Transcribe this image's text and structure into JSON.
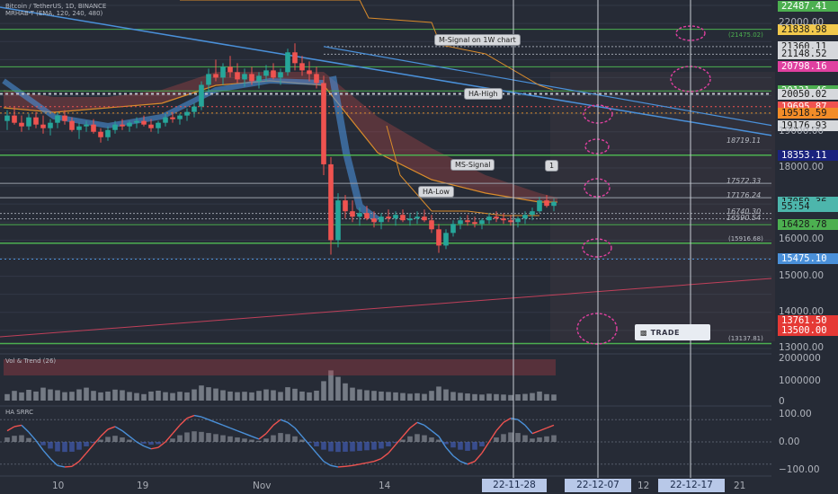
{
  "header": {
    "symbol_line": "Bitcoin / TetherUS, 1D, BINANCE",
    "indicator_line": "MRHAB-T (EMA, 120, 240, 480)"
  },
  "colors": {
    "background": "#262b36",
    "bull": "#26a69a",
    "bear": "#ef5350",
    "green_line": "#4caf50",
    "blue_line": "#4a90d9",
    "orange_line": "#d98b2b",
    "magenta": "#e040a0"
  },
  "chart_data": [
    {
      "type": "candlestick",
      "title": "Bitcoin / TetherUS, 1D, BINANCE",
      "ylim": [
        13000,
        22500
      ],
      "x_tick_labels": [
        "10",
        "19",
        "Nov",
        "14",
        "12",
        "21"
      ],
      "selected_dates": [
        "22-11-28",
        "22-12-07",
        "22-12-17"
      ],
      "candles": [
        [
          19300,
          19600,
          19050,
          19450
        ],
        [
          19450,
          19700,
          19200,
          19250
        ],
        [
          19250,
          19450,
          19000,
          19150
        ],
        [
          19150,
          19500,
          19050,
          19400
        ],
        [
          19400,
          19550,
          19100,
          19200
        ],
        [
          19200,
          19450,
          18950,
          19100
        ],
        [
          19100,
          19350,
          18900,
          19250
        ],
        [
          19250,
          19550,
          19100,
          19450
        ],
        [
          19450,
          19600,
          19200,
          19300
        ],
        [
          19300,
          19400,
          19000,
          19050
        ],
        [
          19050,
          19250,
          18800,
          19150
        ],
        [
          19150,
          19300,
          19000,
          19200
        ],
        [
          19200,
          19350,
          18950,
          19000
        ],
        [
          19000,
          19100,
          18700,
          18850
        ],
        [
          18850,
          19150,
          18750,
          19050
        ],
        [
          19050,
          19300,
          18950,
          19200
        ],
        [
          19200,
          19350,
          19050,
          19150
        ],
        [
          19150,
          19300,
          19000,
          19250
        ],
        [
          19250,
          19400,
          19100,
          19300
        ],
        [
          19300,
          19450,
          19150,
          19200
        ],
        [
          19200,
          19350,
          19000,
          19100
        ],
        [
          19100,
          19300,
          18950,
          19250
        ],
        [
          19250,
          19500,
          19150,
          19400
        ],
        [
          19400,
          19550,
          19250,
          19350
        ],
        [
          19350,
          19500,
          19200,
          19450
        ],
        [
          19450,
          19650,
          19300,
          19550
        ],
        [
          19550,
          19800,
          19400,
          19700
        ],
        [
          19700,
          20400,
          19600,
          20300
        ],
        [
          20300,
          20750,
          20100,
          20600
        ],
        [
          20600,
          21000,
          20400,
          20500
        ],
        [
          20500,
          20900,
          20300,
          20800
        ],
        [
          20800,
          21100,
          20500,
          20650
        ],
        [
          20650,
          20900,
          20350,
          20450
        ],
        [
          20450,
          20750,
          20250,
          20600
        ],
        [
          20600,
          20800,
          20300,
          20400
        ],
        [
          20400,
          20650,
          20200,
          20550
        ],
        [
          20550,
          20850,
          20400,
          20700
        ],
        [
          20700,
          20900,
          20450,
          20500
        ],
        [
          20500,
          20750,
          20300,
          20650
        ],
        [
          20650,
          21300,
          20550,
          21200
        ],
        [
          21200,
          21450,
          20700,
          20900
        ],
        [
          20900,
          21100,
          20550,
          20700
        ],
        [
          20700,
          20950,
          20400,
          20600
        ],
        [
          20600,
          20800,
          20200,
          20350
        ],
        [
          20350,
          20550,
          17800,
          18100
        ],
        [
          18100,
          18300,
          15600,
          16000
        ],
        [
          16000,
          17300,
          15800,
          17100
        ],
        [
          17100,
          17250,
          16600,
          16800
        ],
        [
          16800,
          17100,
          16500,
          16650
        ],
        [
          16650,
          16900,
          16400,
          16750
        ],
        [
          16750,
          16950,
          16550,
          16600
        ],
        [
          16600,
          16800,
          16350,
          16500
        ],
        [
          16500,
          16750,
          16300,
          16650
        ],
        [
          16650,
          16850,
          16500,
          16600
        ],
        [
          16600,
          16800,
          16400,
          16700
        ],
        [
          16700,
          16850,
          16500,
          16550
        ],
        [
          16550,
          16750,
          16400,
          16600
        ],
        [
          16600,
          16800,
          16450,
          16650
        ],
        [
          16650,
          16850,
          16500,
          16550
        ],
        [
          16550,
          16700,
          16200,
          16300
        ],
        [
          16300,
          16450,
          15650,
          15850
        ],
        [
          15850,
          16300,
          15750,
          16200
        ],
        [
          16200,
          16550,
          16100,
          16450
        ],
        [
          16450,
          16650,
          16300,
          16550
        ],
        [
          16550,
          16700,
          16400,
          16500
        ],
        [
          16500,
          16650,
          16350,
          16450
        ],
        [
          16450,
          16600,
          16300,
          16550
        ],
        [
          16550,
          16750,
          16450,
          16650
        ],
        [
          16650,
          16800,
          16500,
          16600
        ],
        [
          16600,
          16750,
          16450,
          16550
        ],
        [
          16550,
          16700,
          16400,
          16500
        ],
        [
          16500,
          16650,
          16350,
          16600
        ],
        [
          16600,
          16800,
          16450,
          16700
        ],
        [
          16700,
          16900,
          16550,
          16800
        ],
        [
          16800,
          17200,
          16750,
          17100
        ],
        [
          17100,
          17250,
          16900,
          16950
        ],
        [
          16950,
          17150,
          16800,
          17059
        ]
      ],
      "price_labels": [
        {
          "value": "22487.41",
          "color": "#4caf50",
          "text_color": "#ffffff"
        },
        {
          "value": "21838.98",
          "color": "#f2c94c",
          "text_color": "#1a1a1a"
        },
        {
          "value": "21360.11",
          "color": "#d6d8dc",
          "text_color": "#1a1a1a"
        },
        {
          "value": "21148.52",
          "color": "#d6d8dc",
          "text_color": "#1a1a1a"
        },
        {
          "value": "20798.16",
          "color": "#e040a0",
          "text_color": "#ffffff"
        },
        {
          "value": "20131.46",
          "color": "#4caf50",
          "text_color": "#ffffff"
        },
        {
          "value": "20050.02",
          "color": "#d6d8dc",
          "text_color": "#1a1a1a"
        },
        {
          "value": "19695.87",
          "color": "#ef5350",
          "text_color": "#ffffff"
        },
        {
          "value": "19518.59",
          "color": "#f28c28",
          "text_color": "#1a1a1a"
        },
        {
          "value": "19176.93",
          "color": "#d6d8dc",
          "text_color": "#1a1a1a"
        },
        {
          "value": "18353.11",
          "color": "#1a237e",
          "text_color": "#ffffff"
        },
        {
          "value": "17059.36",
          "color": "#4db6ac",
          "text_color": "#1a1a1a"
        },
        {
          "value": "55:54",
          "color": "#4db6ac",
          "text_color": "#1a1a1a"
        },
        {
          "value": "16428.78",
          "color": "#4caf50",
          "text_color": "#1a1a1a"
        },
        {
          "value": "15475.10",
          "color": "#4a90d9",
          "text_color": "#ffffff"
        },
        {
          "value": "13761.50",
          "color": "#e53935",
          "text_color": "#ffffff"
        },
        {
          "value": "13500.00",
          "color": "#e53935",
          "text_color": "#ffffff"
        }
      ],
      "axis_prices": [
        "22000.00",
        "19000.00",
        "18000.00",
        "16000.00",
        "15000.00",
        "14000.00",
        "13000.00"
      ],
      "level_lines": [
        {
          "value": "18719.11",
          "label": "18719.11"
        },
        {
          "value": "17572.33",
          "label": "17572.33"
        },
        {
          "value": "17176.24",
          "label": "17176.24"
        },
        {
          "value": "16740.30",
          "label": "16740.30"
        },
        {
          "value": "16590.54",
          "label": "16590.54"
        },
        {
          "value": "15916.68",
          "label": "(15916.68)"
        },
        {
          "value": "13137.81",
          "label": "(13137.81)"
        },
        {
          "value": "21475.02",
          "label": "(21475.02)"
        }
      ],
      "annotations": [
        "M-Signal on 1W chart",
        "HA-High",
        "MS-Signal",
        "HA-Low",
        "1"
      ]
    },
    {
      "type": "bar",
      "title": "Vol & Trend (26)",
      "axis_ticks": [
        "2000000",
        "1000000",
        "0"
      ],
      "values": [
        300,
        450,
        380,
        500,
        420,
        600,
        520,
        480,
        390,
        410,
        520,
        600,
        450,
        380,
        420,
        510,
        480,
        400,
        350,
        300,
        420,
        460,
        390,
        350,
        410,
        380,
        520,
        700,
        620,
        560,
        480,
        420,
        390,
        410,
        380,
        450,
        520,
        480,
        400,
        620,
        550,
        420,
        380,
        460,
        900,
        1400,
        1100,
        800,
        600,
        520,
        480,
        450,
        420,
        400,
        380,
        350,
        320,
        340,
        310,
        450,
        650,
        520,
        400,
        360,
        330,
        300,
        280,
        320,
        300,
        280,
        260,
        290,
        310,
        350,
        420,
        300,
        280
      ]
    },
    {
      "type": "line",
      "title": "HA SRRC",
      "axis_ticks": [
        "100.00",
        "0.00",
        "−100.00"
      ],
      "values": [
        40,
        55,
        60,
        35,
        5,
        -30,
        -60,
        -85,
        -90,
        -88,
        -70,
        -40,
        -10,
        20,
        45,
        55,
        40,
        20,
        0,
        -15,
        -25,
        -20,
        0,
        30,
        60,
        85,
        95,
        90,
        80,
        70,
        60,
        50,
        40,
        30,
        20,
        10,
        30,
        60,
        80,
        70,
        50,
        20,
        -10,
        -40,
        -70,
        -85,
        -90,
        -88,
        -85,
        -80,
        -75,
        -70,
        -60,
        -40,
        -10,
        20,
        50,
        70,
        60,
        40,
        20,
        -20,
        -50,
        -70,
        -80,
        -70,
        -40,
        0,
        40,
        70,
        85,
        80,
        60,
        30,
        40,
        50,
        60
      ]
    }
  ]
}
